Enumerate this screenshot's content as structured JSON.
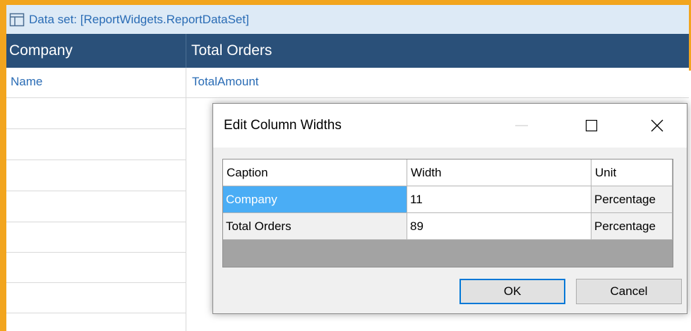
{
  "dataset": {
    "label": "Data set: [ReportWidgets.ReportDataSet]",
    "icon": "table-icon"
  },
  "report_table": {
    "columns": [
      "Company",
      "Total Orders"
    ],
    "fields": [
      "Name",
      "TotalAmount"
    ]
  },
  "dialog": {
    "title": "Edit Column Widths",
    "controls": {
      "minimize_icon": "minimize-icon",
      "maximize_icon": "maximize-icon",
      "close_icon": "close-icon"
    },
    "headers": [
      "Caption",
      "Width",
      "Unit"
    ],
    "rows": [
      {
        "caption": "Company",
        "width": "11",
        "unit": "Percentage",
        "selected": true
      },
      {
        "caption": "Total Orders",
        "width": "89",
        "unit": "Percentage",
        "selected": false
      }
    ],
    "ok_label": "OK",
    "cancel_label": "Cancel"
  },
  "colors": {
    "frame": "#f2a51e",
    "header": "#2a5079",
    "link": "#2a6cb5",
    "selection": "#4aadf5"
  }
}
